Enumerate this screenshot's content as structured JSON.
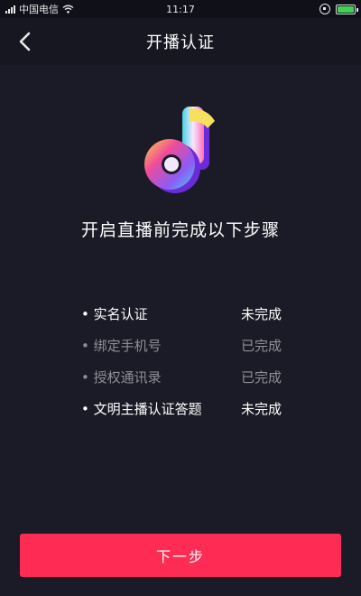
{
  "status_bar": {
    "carrier": "中国电信",
    "time": "11:17",
    "battery_color": "#43d058"
  },
  "header": {
    "title": "开播认证",
    "back_icon": "chevron-left-icon"
  },
  "logo": {
    "icon": "music-note-logo",
    "brand_colors": [
      "#f04b9b",
      "#8b5cf6",
      "#44d3e6",
      "#ffd23f"
    ]
  },
  "main": {
    "headline": "开启直播前完成以下步骤",
    "steps": [
      {
        "label": "实名认证",
        "status": "未完成",
        "completed": false
      },
      {
        "label": "绑定手机号",
        "status": "已完成",
        "completed": true
      },
      {
        "label": "授权通讯录",
        "status": "已完成",
        "completed": true
      },
      {
        "label": "文明主播认证答题",
        "status": "未完成",
        "completed": false
      }
    ]
  },
  "footer": {
    "next_label": "下一步",
    "accent": "#fe2c55"
  }
}
